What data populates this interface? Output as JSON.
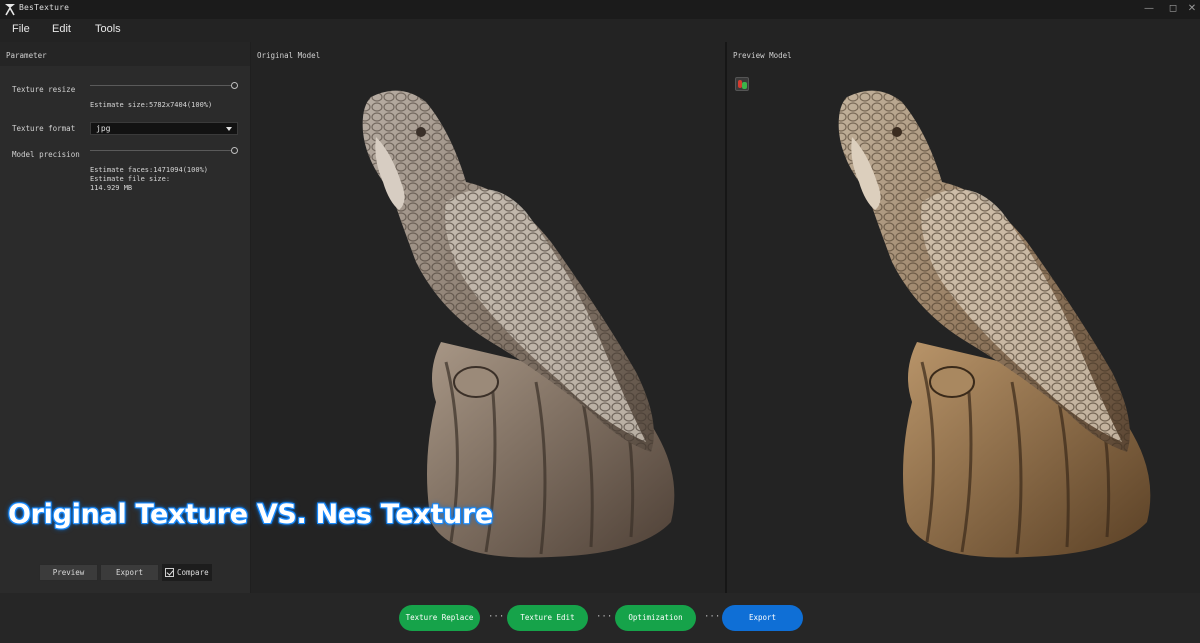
{
  "app": {
    "title": "BesTexture",
    "logo_icon": "app-logo-icon"
  },
  "window_controls": {
    "minimize": "—",
    "maximize": "◻",
    "close": "✕"
  },
  "menu": {
    "items": [
      "File",
      "Edit",
      "Tools"
    ]
  },
  "parameter_panel": {
    "title": "Parameter",
    "texture_resize": {
      "label": "Texture resize",
      "estimate": "Estimate size:5782x7404(100%)",
      "level": 1.0
    },
    "texture_format": {
      "label": "Texture format",
      "selected": "jpg"
    },
    "model_precision": {
      "label": "Model precision",
      "level": 1.0,
      "estimate_faces": "Estimate faces:1471094(100%)",
      "estimate_file_size_label": "Estimate file size:",
      "estimate_file_size_value": "114.929 MB"
    },
    "preview_button": "Preview",
    "export_button": "Export",
    "compare_label": "Compare",
    "compare_checked": true
  },
  "original_viewport": {
    "title": "Original Model"
  },
  "preview_viewport": {
    "title": "Preview Model",
    "tool_icon": "color-picker-icon"
  },
  "overlay_caption": "Original Texture VS. Nes Texture",
  "workflow": {
    "steps": [
      {
        "label": "Texture Replace",
        "color": "#16a34a"
      },
      {
        "label": "Texture Edit",
        "color": "#16a34a"
      },
      {
        "label": "Optimization",
        "color": "#16a34a"
      },
      {
        "label": "Export",
        "color": "#0f6fd6"
      }
    ],
    "separator": "···"
  }
}
